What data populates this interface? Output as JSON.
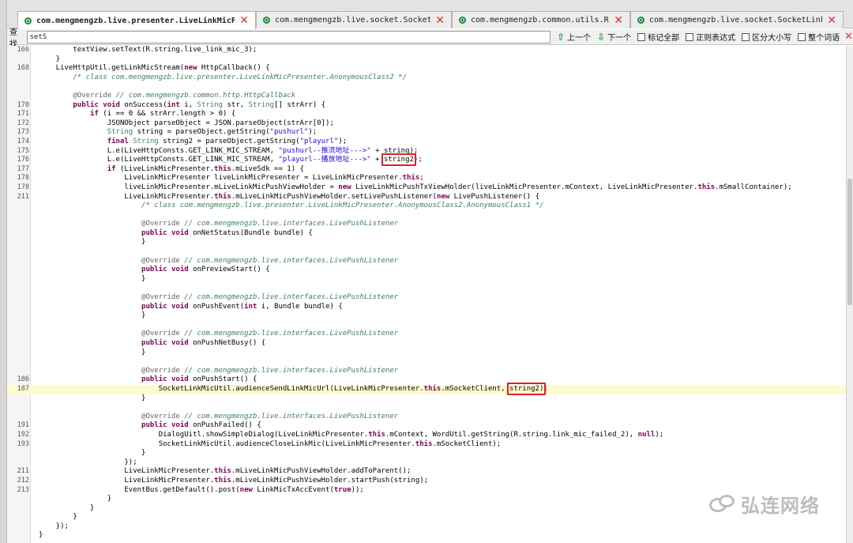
{
  "tabs": [
    {
      "label": "com.mengmengzb.live.presenter.LiveLinkMicPresenter",
      "active": true
    },
    {
      "label": "com.mengmengzb.live.socket.SocketClient",
      "active": false
    },
    {
      "label": "com.mengmengzb.common.utils.RSAUtil",
      "active": false
    },
    {
      "label": "com.mengmengzb.live.socket.SocketLinkMicUtil",
      "active": false
    }
  ],
  "find": {
    "label": "查找",
    "value": "setS",
    "prev": "上一个",
    "next": "下一个",
    "mark_all": "标记全部",
    "regex": "正则表达式",
    "case_sensitive": "区分大小写",
    "whole_word": "整个词语"
  },
  "code_lines": [
    {
      "n": "166",
      "text": "                textView.setText(R.string.live_link_mic_3);"
    },
    {
      "n": "",
      "text": "            }"
    },
    {
      "n": "168",
      "text": "            LiveHttpUtil.getLinkMicStream(new HttpCallback() {"
    },
    {
      "n": "",
      "text": "                /* class com.mengmengzb.live.presenter.LiveLinkMicPresenter.AnonymousClass2 */"
    },
    {
      "n": "",
      "text": ""
    },
    {
      "n": "",
      "text": "                @Override // com.mengmengzb.common.http.HttpCallback"
    },
    {
      "n": "170",
      "text": "                public void onSuccess(int i, String str, String[] strArr) {"
    },
    {
      "n": "171",
      "text": "                    if (i == 0 && strArr.length > 0) {"
    },
    {
      "n": "172",
      "text": "                        JSONObject parseObject = JSON.parseObject(strArr[0]);"
    },
    {
      "n": "173",
      "text": "                        String string = parseObject.getString(\"pushurl\");"
    },
    {
      "n": "174",
      "text": "                        final String string2 = parseObject.getString(\"playurl\");"
    },
    {
      "n": "175",
      "text": "                        L.e(LiveHttpConsts.GET_LINK_MIC_STREAM, \"pushurl--推流地址--->\" + string);"
    },
    {
      "n": "176",
      "text": "                        L.e(LiveHttpConsts.GET_LINK_MIC_STREAM, \"playurl--播放地址--->\" + string2);"
    },
    {
      "n": "177",
      "text": "                        if (LiveLinkMicPresenter.this.mLiveSdk == 1) {"
    },
    {
      "n": "178",
      "text": "                            LiveLinkMicPresenter liveLinkMicPresenter = LiveLinkMicPresenter.this;"
    },
    {
      "n": "178",
      "text": "                            liveLinkMicPresenter.mLiveLinkMicPushViewHolder = new LiveLinkMicPushTxViewHolder(liveLinkMicPresenter.mContext, LiveLinkMicPresenter.this.mSmallContainer);"
    },
    {
      "n": "211",
      "text": "                            LiveLinkMicPresenter.this.mLiveLinkMicPushViewHolder.setLivePushListener(new LivePushListener() {"
    },
    {
      "n": "",
      "text": "                                /* class com.mengmengzb.live.presenter.LiveLinkMicPresenter.AnonymousClass2.AnonymousClass1 */"
    },
    {
      "n": "",
      "text": ""
    },
    {
      "n": "",
      "text": "                                @Override // com.mengmengzb.live.interfaces.LivePushListener"
    },
    {
      "n": "",
      "text": "                                public void onNetStatus(Bundle bundle) {"
    },
    {
      "n": "",
      "text": "                                }"
    },
    {
      "n": "",
      "text": ""
    },
    {
      "n": "",
      "text": "                                @Override // com.mengmengzb.live.interfaces.LivePushListener"
    },
    {
      "n": "",
      "text": "                                public void onPreviewStart() {"
    },
    {
      "n": "",
      "text": "                                }"
    },
    {
      "n": "",
      "text": ""
    },
    {
      "n": "",
      "text": "                                @Override // com.mengmengzb.live.interfaces.LivePushListener"
    },
    {
      "n": "",
      "text": "                                public void onPushEvent(int i, Bundle bundle) {"
    },
    {
      "n": "",
      "text": "                                }"
    },
    {
      "n": "",
      "text": ""
    },
    {
      "n": "",
      "text": "                                @Override // com.mengmengzb.live.interfaces.LivePushListener"
    },
    {
      "n": "",
      "text": "                                public void onPushNetBusy() {"
    },
    {
      "n": "",
      "text": "                                }"
    },
    {
      "n": "",
      "text": ""
    },
    {
      "n": "",
      "text": "                                @Override // com.mengmengzb.live.interfaces.LivePushListener"
    },
    {
      "n": "186",
      "text": "                                public void onPushStart() {"
    },
    {
      "n": "187",
      "text": "                                    SocketLinkMicUtil.audienceSendLinkMicUrl(LiveLinkMicPresenter.this.mSocketClient, string2);"
    },
    {
      "n": "",
      "text": "                                }"
    },
    {
      "n": "",
      "text": ""
    },
    {
      "n": "",
      "text": "                                @Override // com.mengmengzb.live.interfaces.LivePushListener"
    },
    {
      "n": "191",
      "text": "                                public void onPushFailed() {"
    },
    {
      "n": "192",
      "text": "                                    DialogUitl.showSimpleDialog(LiveLinkMicPresenter.this.mContext, WordUtil.getString(R.string.link_mic_failed_2), null);"
    },
    {
      "n": "193",
      "text": "                                    SocketLinkMicUtil.audienceCloseLinkMic(LiveLinkMicPresenter.this.mSocketClient);"
    },
    {
      "n": "",
      "text": "                                }"
    },
    {
      "n": "",
      "text": "                            });"
    },
    {
      "n": "211",
      "text": "                            LiveLinkMicPresenter.this.mLiveLinkMicPushViewHolder.addToParent();"
    },
    {
      "n": "212",
      "text": "                            LiveLinkMicPresenter.this.mLiveLinkMicPushViewHolder.startPush(string);"
    },
    {
      "n": "213",
      "text": "                            EventBus.getDefault().post(new LinkMicTxAccEvent(true));"
    },
    {
      "n": "",
      "text": "                        }"
    },
    {
      "n": "",
      "text": "                    }"
    },
    {
      "n": "",
      "text": "                }"
    },
    {
      "n": "",
      "text": "            });"
    },
    {
      "n": "",
      "text": "        }"
    }
  ],
  "highlighted_line": "187",
  "watermark": "弘连网络"
}
